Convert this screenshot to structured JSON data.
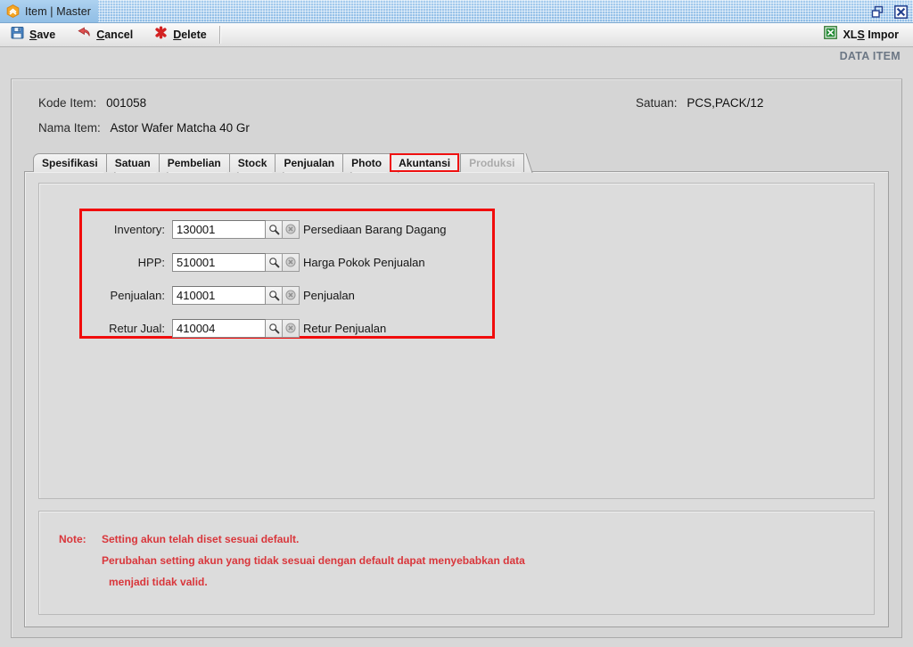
{
  "window": {
    "title": "Item | Master",
    "app_icon": "hexagon-chevron-icon",
    "restore_icon": "restore-window-icon",
    "close_icon": "close-window-icon"
  },
  "toolbar": {
    "save_label": "Save",
    "cancel_label": "Cancel",
    "delete_label": "Delete",
    "xls_label": "XLS Impor"
  },
  "page": {
    "data_item_label": "DATA ITEM"
  },
  "header": {
    "kode_item_label": "Kode Item:",
    "kode_item_value": "001058",
    "nama_item_label": "Nama Item:",
    "nama_item_value": "Astor Wafer Matcha 40 Gr",
    "satuan_label": "Satuan:",
    "satuan_value": "PCS,PACK/12"
  },
  "tabs": [
    {
      "label": "Spesifikasi",
      "state": "normal"
    },
    {
      "label": "Satuan",
      "state": "normal"
    },
    {
      "label": "Pembelian",
      "state": "normal"
    },
    {
      "label": "Stock",
      "state": "normal"
    },
    {
      "label": "Penjualan",
      "state": "normal"
    },
    {
      "label": "Photo",
      "state": "normal"
    },
    {
      "label": "Akuntansi",
      "state": "active"
    },
    {
      "label": "Produksi",
      "state": "disabled"
    }
  ],
  "accounting_rows": [
    {
      "label": "Inventory:",
      "value": "130001",
      "description": "Persediaan Barang Dagang",
      "search_icon": "magnifier-icon",
      "clear_icon": "clear-circle-icon"
    },
    {
      "label": "HPP:",
      "value": "510001",
      "description": "Harga Pokok Penjualan",
      "search_icon": "magnifier-icon",
      "clear_icon": "clear-circle-icon"
    },
    {
      "label": "Penjualan:",
      "value": "410001",
      "description": "Penjualan",
      "search_icon": "magnifier-icon",
      "clear_icon": "clear-circle-icon"
    },
    {
      "label": "Retur Jual:",
      "value": "410004",
      "description": "Retur Penjualan",
      "search_icon": "magnifier-icon",
      "clear_icon": "clear-circle-icon"
    }
  ],
  "note": {
    "label": "Note:",
    "line1": "Setting akun telah diset sesuai default.",
    "line2": "Perubahan setting akun yang tidak sesuai dengan default dapat menyebabkan data",
    "line3": "menjadi tidak valid."
  },
  "colors": {
    "highlight_border": "#f10c0c",
    "note_text": "#d9363b",
    "titlebar": "#9cc5ea",
    "data_item_text": "#6c7785"
  }
}
